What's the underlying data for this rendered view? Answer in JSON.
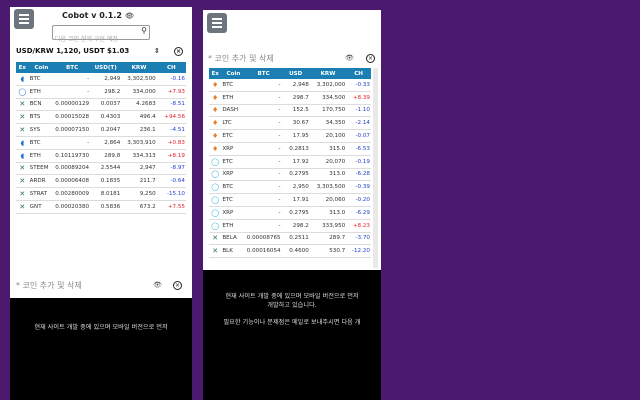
{
  "left": {
    "title": "Cobot v 0.1.2",
    "title_icon": "eye-icon",
    "search_placeholder": "다음 코인 현재 구현 예정",
    "rate_text": "USD/KRW 1,120, USDT $1.03",
    "table_headers": [
      "Ex",
      "Coin",
      "BTC",
      "USD(T)",
      "KRW",
      "CH"
    ],
    "rows": [
      {
        "ex": "bittrex",
        "coin": "BTC",
        "btc": "-",
        "usd": "2,949",
        "krw": "3,302,500",
        "ch": "-0.16",
        "dir": "down"
      },
      {
        "ex": "upbit",
        "coin": "ETH",
        "btc": "-",
        "usd": "298.2",
        "krw": "334,000",
        "ch": "+7.93",
        "dir": "up"
      },
      {
        "ex": "poloniex",
        "coin": "BCN",
        "btc": "0.00000129",
        "usd": "0.0037",
        "krw": "4.2683",
        "ch": "-8.51",
        "dir": "down"
      },
      {
        "ex": "poloniex",
        "coin": "BTS",
        "btc": "0.00015028",
        "usd": "0.4303",
        "krw": "496.4",
        "ch": "+94.56",
        "dir": "up"
      },
      {
        "ex": "poloniex",
        "coin": "SYS",
        "btc": "0.00007150",
        "usd": "0.2047",
        "krw": "236.1",
        "ch": "-4.51",
        "dir": "down"
      },
      {
        "ex": "bittrex",
        "coin": "BTC",
        "btc": "-",
        "usd": "2,864",
        "krw": "3,303,910",
        "ch": "+0.83",
        "dir": "up"
      },
      {
        "ex": "bittrex",
        "coin": "ETH",
        "btc": "0.10119730",
        "usd": "289.8",
        "krw": "334,313",
        "ch": "+8.19",
        "dir": "up"
      },
      {
        "ex": "poloniex",
        "coin": "STEEM",
        "btc": "0.00089204",
        "usd": "2.5544",
        "krw": "2,947",
        "ch": "-8.97",
        "dir": "down"
      },
      {
        "ex": "poloniex",
        "coin": "ARDR",
        "btc": "0.00006408",
        "usd": "0.1835",
        "krw": "211.7",
        "ch": "-0.64",
        "dir": "down"
      },
      {
        "ex": "poloniex",
        "coin": "STRAT",
        "btc": "0.00280009",
        "usd": "8.0181",
        "krw": "9,250",
        "ch": "-15.10",
        "dir": "down"
      },
      {
        "ex": "poloniex",
        "coin": "GNT",
        "btc": "0.00020380",
        "usd": "0.5836",
        "krw": "673.2",
        "ch": "+7.55",
        "dir": "up"
      }
    ],
    "add_label": "* 코인 추가 및 삭제",
    "footer_line": "현재 사이트 개발 중에 있으며 모바일 버전으로 먼저"
  },
  "right": {
    "add_label": "* 코인 추가 및 삭제",
    "table_headers": [
      "Ex",
      "Coin",
      "BTC",
      "USD",
      "KRW",
      "CH"
    ],
    "rows": [
      {
        "ex": "bithumb",
        "coin": "BTC",
        "btc": "-",
        "usd": "2,948",
        "krw": "3,302,000",
        "ch": "-0.33",
        "dir": "down"
      },
      {
        "ex": "bithumb",
        "coin": "ETH",
        "btc": "-",
        "usd": "298.7",
        "krw": "334,500",
        "ch": "+8.39",
        "dir": "up"
      },
      {
        "ex": "bithumb",
        "coin": "DASH",
        "btc": "-",
        "usd": "152.5",
        "krw": "170,750",
        "ch": "-1.10",
        "dir": "down"
      },
      {
        "ex": "bithumb",
        "coin": "LTC",
        "btc": "-",
        "usd": "30.67",
        "krw": "34,350",
        "ch": "-2.14",
        "dir": "down"
      },
      {
        "ex": "bithumb",
        "coin": "ETC",
        "btc": "-",
        "usd": "17.95",
        "krw": "20,100",
        "ch": "-0.07",
        "dir": "down"
      },
      {
        "ex": "bithumb",
        "coin": "XRP",
        "btc": "-",
        "usd": "0.2813",
        "krw": "315.0",
        "ch": "-6.53",
        "dir": "down"
      },
      {
        "ex": "coinone",
        "coin": "ETC",
        "btc": "-",
        "usd": "17.92",
        "krw": "20,070",
        "ch": "-0.19",
        "dir": "down"
      },
      {
        "ex": "coinone",
        "coin": "XRP",
        "btc": "-",
        "usd": "0.2795",
        "krw": "313.0",
        "ch": "-6.28",
        "dir": "down"
      },
      {
        "ex": "coinone",
        "coin": "BTC",
        "btc": "-",
        "usd": "2,950",
        "krw": "3,303,500",
        "ch": "-0.39",
        "dir": "down"
      },
      {
        "ex": "coinone",
        "coin": "ETC",
        "btc": "-",
        "usd": "17.91",
        "krw": "20,060",
        "ch": "-0.20",
        "dir": "down"
      },
      {
        "ex": "coinone",
        "coin": "XRP",
        "btc": "-",
        "usd": "0.2795",
        "krw": "313.0",
        "ch": "-6.29",
        "dir": "down"
      },
      {
        "ex": "coinone",
        "coin": "ETH",
        "btc": "-",
        "usd": "298.2",
        "krw": "333,950",
        "ch": "+8.23",
        "dir": "up"
      },
      {
        "ex": "poloniex",
        "coin": "BELA",
        "btc": "0.00008765",
        "usd": "0.2511",
        "krw": "289.7",
        "ch": "-3.70",
        "dir": "down"
      },
      {
        "ex": "poloniex",
        "coin": "BLK",
        "btc": "0.00016054",
        "usd": "0.4600",
        "krw": "530.7",
        "ch": "-12.20",
        "dir": "down"
      }
    ],
    "footer_lines": [
      "현재 사이트 개발 중에 있으며 모바일 버전으로 먼저",
      "개발하고 있습니다.",
      "필요한 기능이나 문제점은 메일로 보내주시면 다음 개"
    ]
  }
}
